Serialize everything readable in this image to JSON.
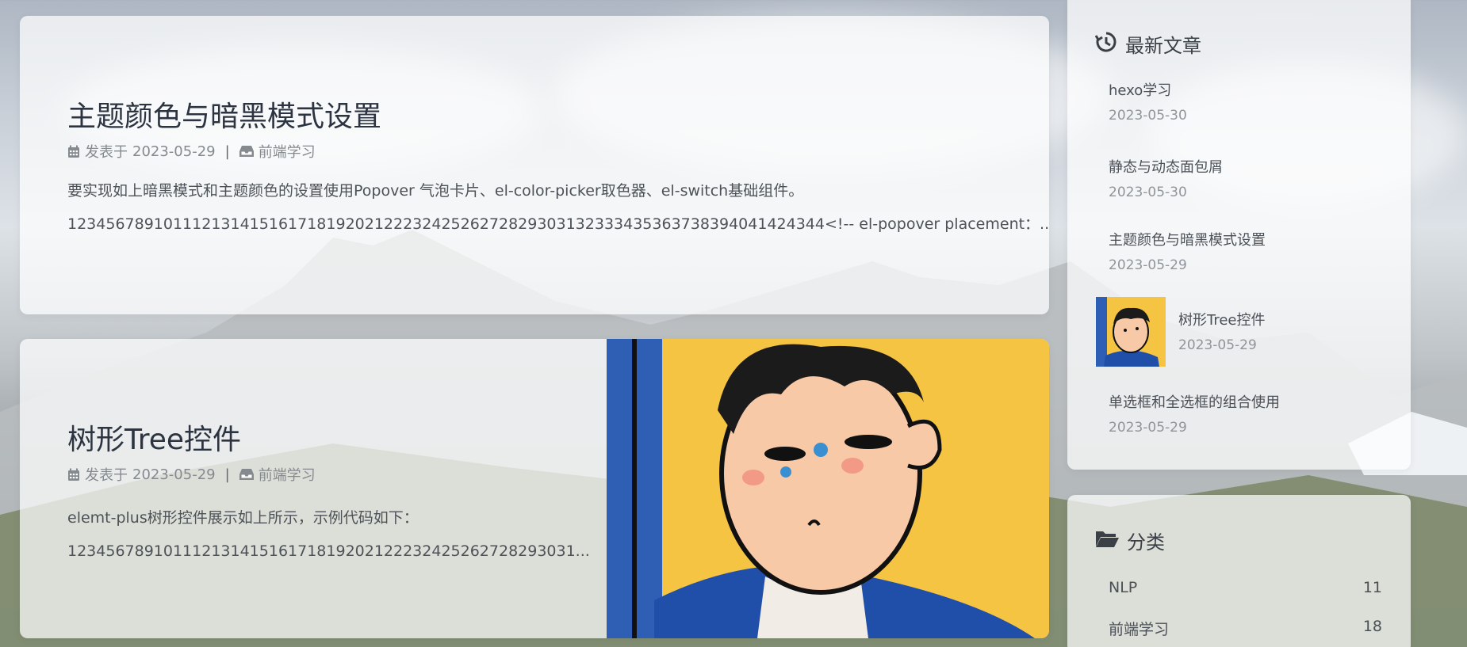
{
  "posts": [
    {
      "title": "主题颜色与暗黑模式设置",
      "meta_prefix": "发表于",
      "date": "2023-05-29",
      "category": "前端学习",
      "excerpt_line1": "要实现如上暗黑模式和主题颜色的设置使用Popover 气泡卡片、el-color-picker取色器、el-switch基础组件。",
      "excerpt_line2": "1234567891011121314151617181920212223242526272829303132333435363738394041424344<!-- el-popover placement：..."
    },
    {
      "title": "树形Tree控件",
      "meta_prefix": "发表于",
      "date": "2023-05-29",
      "category": "前端学习",
      "excerpt_line1": "elemt-plus树形控件展示如上所示，示例代码如下：",
      "excerpt_line2": "12345678910111213141516171819202122232425262728293031..."
    }
  ],
  "recent": {
    "heading": "最新文章",
    "items": [
      {
        "title": "hexo学习",
        "date": "2023-05-30"
      },
      {
        "title": "静态与动态面包屑",
        "date": "2023-05-30"
      },
      {
        "title": "主题颜色与暗黑模式设置",
        "date": "2023-05-29"
      },
      {
        "title": "树形Tree控件",
        "date": "2023-05-29"
      },
      {
        "title": "单选框和全选框的组合使用",
        "date": "2023-05-29"
      }
    ]
  },
  "categories": {
    "heading": "分类",
    "items": [
      {
        "name": "NLP",
        "count": "11"
      },
      {
        "name": "前端学习",
        "count": "18"
      }
    ]
  },
  "icons": {
    "calendar": "calendar-icon",
    "inbox": "inbox-icon",
    "history": "history-icon",
    "folder": "folder-open-icon"
  }
}
